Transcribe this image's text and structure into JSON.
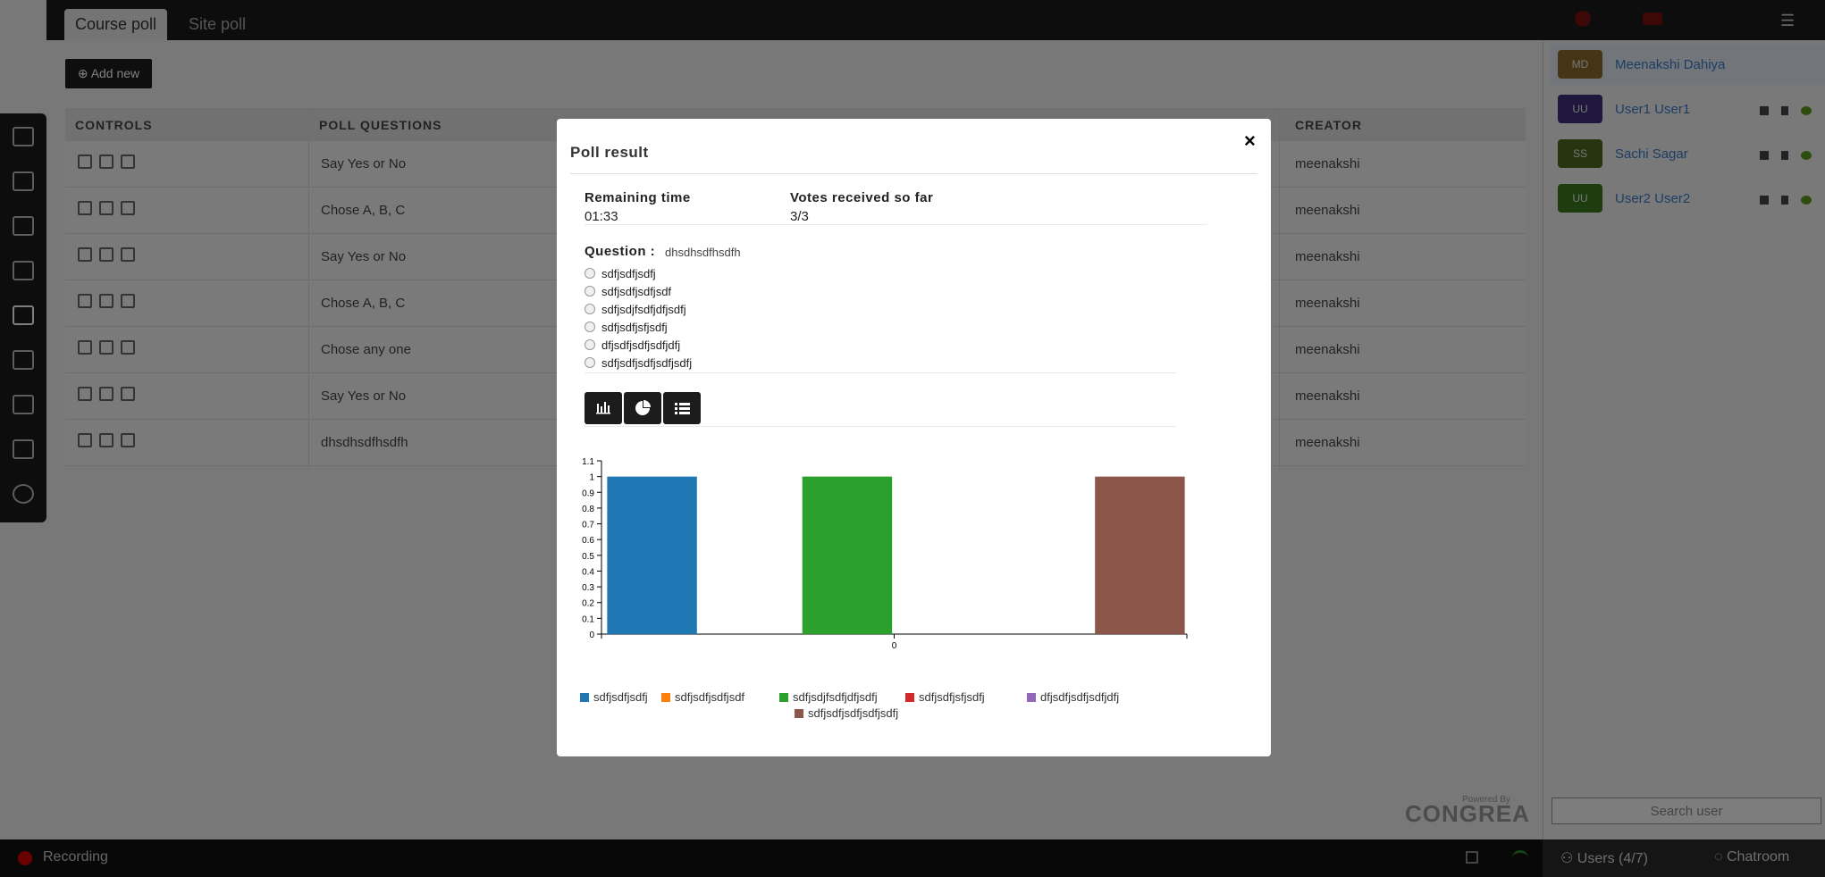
{
  "tabs": [
    "Course poll",
    "Site poll"
  ],
  "add_new_label": "Add new",
  "table": {
    "headers": [
      "CONTROLS",
      "POLL QUESTIONS",
      "CREATOR"
    ],
    "rows": [
      {
        "question": "Say Yes or No",
        "creator": "meenakshi"
      },
      {
        "question": "Chose A, B, C",
        "creator": "meenakshi"
      },
      {
        "question": "Say Yes or No",
        "creator": "meenakshi"
      },
      {
        "question": "Chose A, B, C",
        "creator": "meenakshi"
      },
      {
        "question": "Chose any one",
        "creator": "meenakshi"
      },
      {
        "question": "Say Yes or No",
        "creator": "meenakshi"
      },
      {
        "question": "dhsdhsdfhsdfh",
        "creator": "meenakshi"
      }
    ]
  },
  "users": [
    {
      "initials": "MD",
      "name": "Meenakshi Dahiya",
      "color": "#8a6a2c"
    },
    {
      "initials": "UU",
      "name": "User1 User1",
      "color": "#3e2f7a"
    },
    {
      "initials": "SS",
      "name": "Sachi Sagar",
      "color": "#4e6a1e"
    },
    {
      "initials": "UU",
      "name": "User2 User2",
      "color": "#3b7a1e"
    }
  ],
  "search_user_placeholder": "Search user",
  "powered_by": "Powered By",
  "brand": "CONGREA",
  "bottom": {
    "recording": "Recording",
    "users": "Users (4/7)",
    "chatroom": "Chatroom"
  },
  "modal": {
    "title": "Poll result",
    "close": "×",
    "remaining_label": "Remaining time",
    "remaining_value": "01:33",
    "votes_label": "Votes received so far",
    "votes_value": "3/3",
    "question_label": "Question :",
    "question": "dhsdhsdfhsdfh",
    "options": [
      "sdfjsdfjsdfj",
      "sdfjsdfjsdfjsdf",
      "sdfjsdjfsdfjdfjsdfj",
      "sdfjsdfjsfjsdfj",
      "dfjsdfjsdfjsdfjdfj",
      "sdfjsdfjsdfjsdfjsdfj"
    ],
    "view_buttons": [
      "bar-chart-icon",
      "pie-chart-icon",
      "list-icon"
    ]
  },
  "chart_data": {
    "type": "bar",
    "categories": [
      "0"
    ],
    "series": [
      {
        "name": "sdfjsdfjsdfj",
        "values": [
          1
        ],
        "color": "#1f77b4"
      },
      {
        "name": "sdfjsdfjsdfjsdf",
        "values": [
          0
        ],
        "color": "#ff7f0e"
      },
      {
        "name": "sdfjsdjfsdfjdfjsdfj",
        "values": [
          1
        ],
        "color": "#2ca02c"
      },
      {
        "name": "sdfjsdfjsfjsdfj",
        "values": [
          0
        ],
        "color": "#d62728"
      },
      {
        "name": "dfjsdfjsdfjsdfjdfj",
        "values": [
          0
        ],
        "color": "#9467bd"
      },
      {
        "name": "sdfjsdfjsdfjsdfjsdfj",
        "values": [
          1
        ],
        "color": "#8c564b"
      }
    ],
    "yticks": [
      "0",
      "0.1",
      "0.2",
      "0.3",
      "0.4",
      "0.5",
      "0.6",
      "0.7",
      "0.8",
      "0.9",
      "1",
      "1.1"
    ],
    "ylim": [
      0,
      1.1
    ],
    "legend": "bottom"
  }
}
